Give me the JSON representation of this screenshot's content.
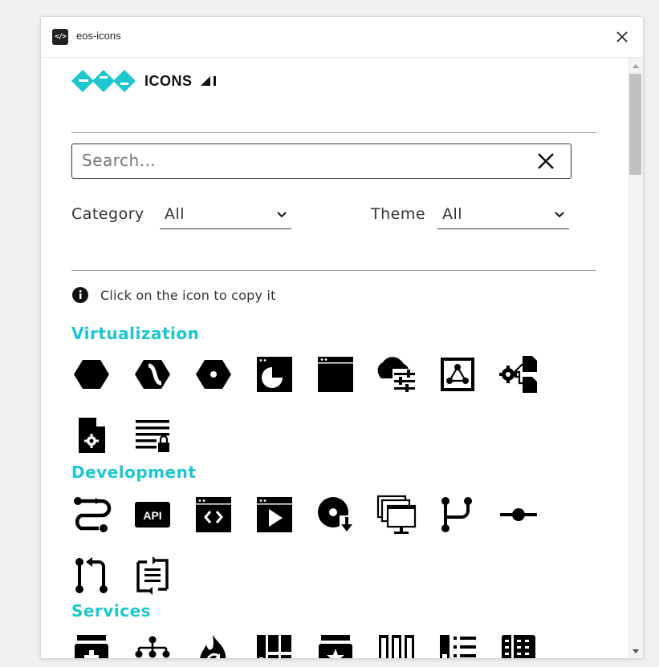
{
  "window": {
    "title": "eos-icons",
    "app_icon_glyph": "</>"
  },
  "logo": {
    "text": "ICONS",
    "brand_color": "#1cc7d0"
  },
  "search": {
    "placeholder": "Search...",
    "value": ""
  },
  "filters": {
    "category": {
      "label": "Category",
      "value": "All"
    },
    "theme": {
      "label": "Theme",
      "value": "All"
    }
  },
  "info": {
    "text": "Click on the icon to copy it"
  },
  "sections": [
    {
      "title": "Virtualization",
      "icons": [
        "hexagon-icon",
        "hexagon-split-icon",
        "hexagon-dot-icon",
        "window-chart-icon",
        "application-window-icon",
        "cloud-settings-icon",
        "network-node-icon",
        "settings-files-icon",
        "file-settings-icon",
        "text-lock-icon"
      ]
    },
    {
      "title": "Development",
      "icons": [
        "route-icon",
        "api-icon",
        "code-window-icon",
        "play-window-icon",
        "disk-download-icon",
        "desktop-stack-icon",
        "branch-icon",
        "commit-icon",
        "pull-request-icon",
        "compare-icon"
      ]
    },
    {
      "title": "Services",
      "icons": [
        "medical-box-icon",
        "hierarchy-icon",
        "fire-sync-icon",
        "storage-columns-icon",
        "star-box-icon",
        "disk-array-icon",
        "storage-list-icon",
        "book-rack-icon"
      ]
    }
  ],
  "colors": {
    "accent": "#1cc7d0",
    "text": "#333333",
    "icon": "#000000"
  }
}
